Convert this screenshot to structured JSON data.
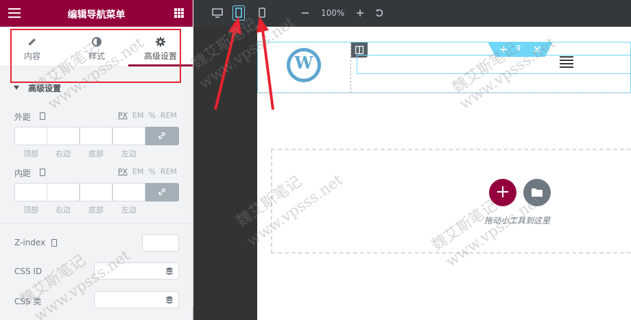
{
  "panel": {
    "title": "编辑导航菜单",
    "tabs": [
      {
        "label": "内容",
        "icon": "pencil-icon"
      },
      {
        "label": "样式",
        "icon": "contrast-icon"
      },
      {
        "label": "高级设置",
        "icon": "gear-icon",
        "active": true
      }
    ],
    "section_title": "高级设置",
    "margin": {
      "label": "外距",
      "units": [
        "PX",
        "EM",
        "%",
        "REM"
      ],
      "selected_unit": "PX",
      "sides": [
        "顶部",
        "右边",
        "底部",
        "左边"
      ]
    },
    "padding": {
      "label": "内距",
      "units": [
        "PX",
        "EM",
        "%",
        "REM"
      ],
      "selected_unit": "PX",
      "sides": [
        "顶部",
        "右边",
        "底部",
        "左边"
      ]
    },
    "z_index": {
      "label": "Z-index",
      "value": ""
    },
    "css_id": {
      "label": "CSS ID",
      "value": ""
    },
    "css_class": {
      "label": "CSS 类",
      "value": ""
    }
  },
  "toolbar": {
    "devices": [
      "desktop-icon",
      "tablet-icon",
      "mobile-icon"
    ],
    "active_device": "tablet-icon",
    "zoom": "100%"
  },
  "canvas": {
    "drop_text": "拖动小工具到这里"
  },
  "watermark": {
    "text_cn": "魏艾斯笔记",
    "text_url": "www.vpsss.net"
  },
  "colors": {
    "brand": "#93003c",
    "selection": "#71d7f7",
    "highlight": "#e8222f",
    "toolbar_bg": "#34383c"
  }
}
